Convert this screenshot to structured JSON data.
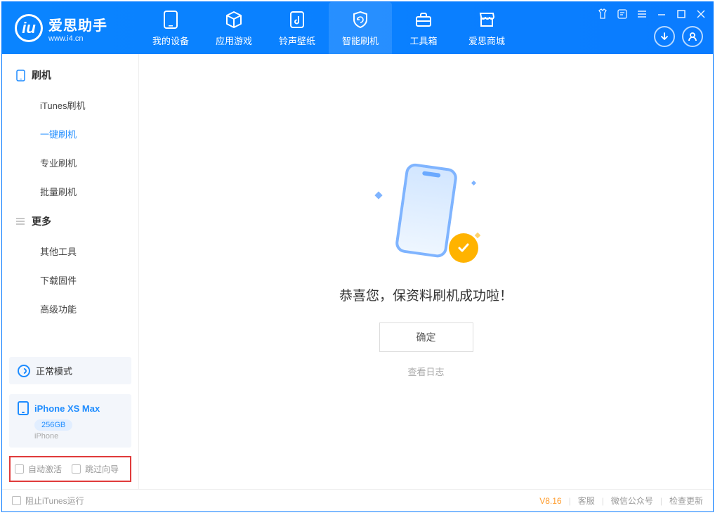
{
  "app": {
    "name": "爱思助手",
    "url": "www.i4.cn"
  },
  "nav": {
    "items": [
      {
        "label": "我的设备"
      },
      {
        "label": "应用游戏"
      },
      {
        "label": "铃声壁纸"
      },
      {
        "label": "智能刷机"
      },
      {
        "label": "工具箱"
      },
      {
        "label": "爱思商城"
      }
    ],
    "active_index": 3
  },
  "sidebar": {
    "sections": [
      {
        "title": "刷机",
        "items": [
          "iTunes刷机",
          "一键刷机",
          "专业刷机",
          "批量刷机"
        ],
        "active_index": 1
      },
      {
        "title": "更多",
        "items": [
          "其他工具",
          "下载固件",
          "高级功能"
        ],
        "active_index": -1
      }
    ],
    "mode_label": "正常模式",
    "device": {
      "name": "iPhone XS Max",
      "capacity": "256GB",
      "type": "iPhone"
    },
    "options": {
      "auto_activate": "自动激活",
      "skip_guide": "跳过向导"
    }
  },
  "main": {
    "success_message": "恭喜您，保资料刷机成功啦！",
    "ok_button": "确定",
    "view_log": "查看日志"
  },
  "footer": {
    "block_itunes": "阻止iTunes运行",
    "version": "V8.16",
    "links": [
      "客服",
      "微信公众号",
      "检查更新"
    ]
  }
}
